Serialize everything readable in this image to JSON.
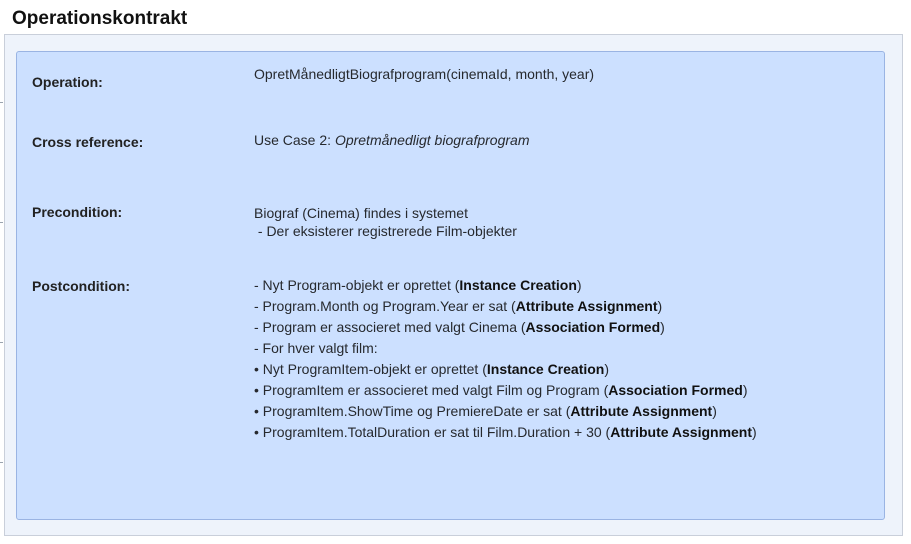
{
  "title": "Operationskontrakt",
  "rows": {
    "operation": {
      "label": "Operation:",
      "value": "OpretMånedligtBiografprogram(cinemaId, month, year)"
    },
    "cross_reference": {
      "label": "Cross reference:",
      "prefix": "Use Case 2: ",
      "emphasis": "Opretmånedligt biografprogram"
    },
    "precondition": {
      "label": "Precondition:",
      "lines": [
        "Biograf (Cinema) findes i systemet",
        " - Der eksisterer registrerede Film-objekter"
      ]
    },
    "postcondition": {
      "label": "Postcondition:",
      "lines": [
        {
          "text": "- Nyt Program-objekt er oprettet (",
          "bold": "Instance Creation",
          "end": ")"
        },
        {
          "text": "- Program.Month og Program.Year er sat (",
          "bold": "Attribute Assignment",
          "end": ")"
        },
        {
          "text": "- Program er associeret med valgt Cinema (",
          "bold": "Association Formed",
          "end": ")"
        },
        {
          "text": "- For hver valgt film:",
          "bold": "",
          "end": ""
        },
        {
          "text": "• Nyt ProgramItem-objekt er oprettet (",
          "bold": "Instance Creation",
          "end": ")"
        },
        {
          "text": "• ProgramItem er associeret med valgt Film og Program (",
          "bold": "Association Formed",
          "end": ")"
        },
        {
          "text": "• ProgramItem.ShowTime og PremiereDate er sat (",
          "bold": "Attribute Assignment",
          "end": ")"
        },
        {
          "text": "• ProgramItem.TotalDuration er sat til Film.Duration + 30 (",
          "bold": "Attribute Assignment",
          "end": ")"
        }
      ]
    }
  }
}
